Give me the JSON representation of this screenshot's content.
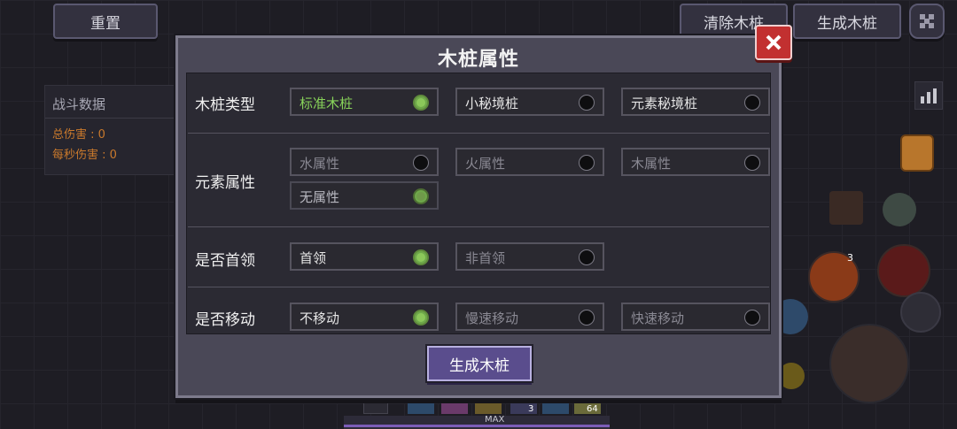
{
  "top_bar": {
    "reset_label": "重置",
    "clear_label": "清除木桩",
    "spawn_label": "生成木桩"
  },
  "stats_panel": {
    "title": "战斗数据",
    "total_damage": "总伤害 : 0",
    "dps": "每秒伤害 : 0"
  },
  "dialog": {
    "title": "木桩属性",
    "rows": {
      "type": {
        "label": "木桩类型",
        "options": [
          {
            "label": "标准木桩",
            "selected": true
          },
          {
            "label": "小秘境桩",
            "selected": false
          },
          {
            "label": "元素秘境桩",
            "selected": false
          }
        ]
      },
      "element": {
        "label": "元素属性",
        "options": [
          {
            "label": "水属性",
            "selected": false
          },
          {
            "label": "火属性",
            "selected": false
          },
          {
            "label": "木属性",
            "selected": false
          },
          {
            "label": "无属性",
            "selected": true
          }
        ]
      },
      "boss": {
        "label": "是否首领",
        "options": [
          {
            "label": "首领",
            "selected": true
          },
          {
            "label": "非首领",
            "selected": false
          }
        ]
      },
      "move": {
        "label": "是否移动",
        "options": [
          {
            "label": "不移动",
            "selected": true
          },
          {
            "label": "慢速移动",
            "selected": false
          },
          {
            "label": "快速移动",
            "selected": false
          }
        ]
      }
    },
    "confirm_label": "生成木桩"
  },
  "hud": {
    "skill_count_a": "3",
    "skill_count_b": "3",
    "skill_count_c": "64",
    "max_label": "MAX"
  },
  "colors": {
    "selected_radio": "#8bc75a",
    "close_button": "#c23030",
    "confirm_button": "#5a4d8d"
  }
}
